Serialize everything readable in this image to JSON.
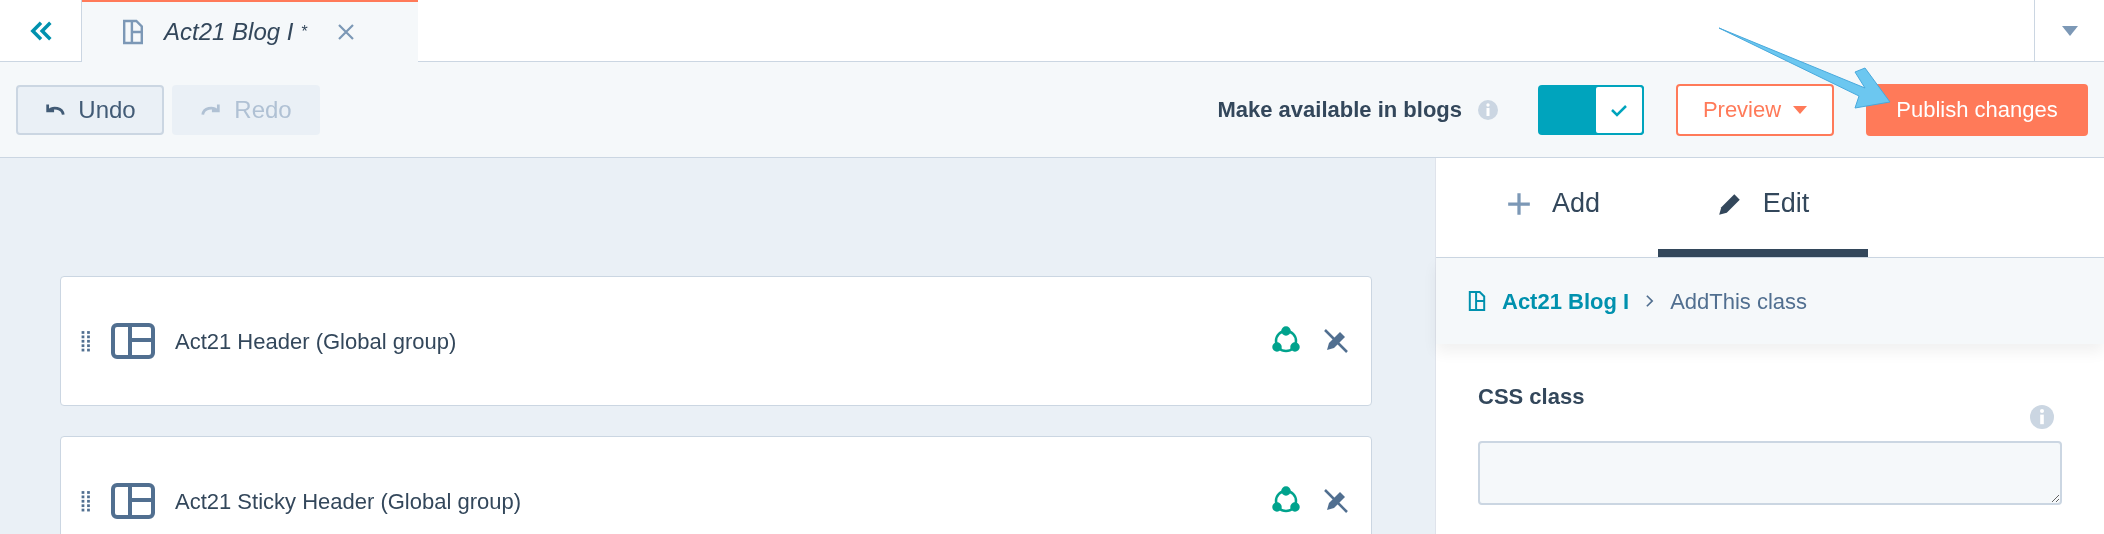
{
  "tab_bar": {
    "document_tab": {
      "title": "Act21 Blog I",
      "unsaved_mark": "*",
      "selected": true
    }
  },
  "toolbar": {
    "undo": {
      "label": "Undo",
      "disabled": false
    },
    "redo": {
      "label": "Redo",
      "disabled": true
    },
    "availability": {
      "label": "Make available in blogs",
      "on": true
    },
    "preview": {
      "label": "Preview"
    },
    "publish": {
      "label": "Publish changes"
    }
  },
  "modules": [
    {
      "name": "Act21 Header (Global group)"
    },
    {
      "name": "Act21 Sticky Header (Global group)"
    }
  ],
  "side_panel": {
    "tabs": [
      {
        "label": "Add",
        "kind": "add",
        "selected": false
      },
      {
        "label": "Edit",
        "kind": "edit",
        "selected": true
      }
    ],
    "breadcrumb": {
      "root": "Act21 Blog I",
      "current": "AddThis class"
    },
    "field": {
      "label": "CSS class"
    }
  }
}
